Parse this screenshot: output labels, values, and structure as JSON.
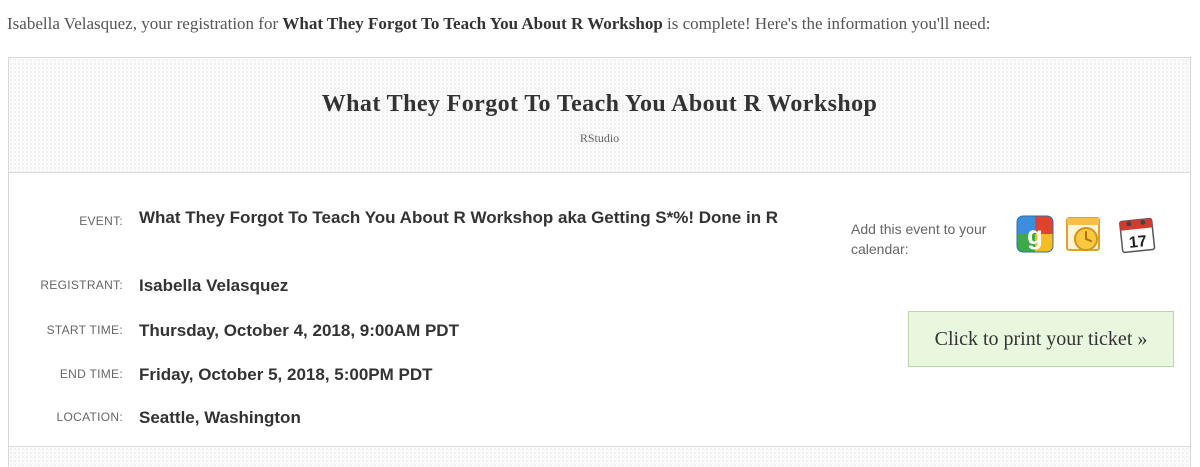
{
  "intro": {
    "prefix": "Isabella Velasquez, your registration for ",
    "event_name": "What They Forgot To Teach You About R Workshop",
    "suffix": " is complete! Here's the information you'll need:"
  },
  "header": {
    "title": "What They Forgot To Teach You About R Workshop",
    "organizer": "RStudio"
  },
  "details": {
    "event_label": "EVENT:",
    "event_value": "What They Forgot To Teach You About R Workshop aka Getting S*%! Done in R",
    "registrant_label": "REGISTRANT:",
    "registrant_value": "Isabella Velasquez",
    "start_label": "START TIME:",
    "start_value": "Thursday, October 4, 2018, 9:00AM PDT",
    "end_label": "END TIME:",
    "end_value": "Friday, October 5, 2018, 5:00PM PDT",
    "location_label": "LOCATION:",
    "location_value": "Seattle, Washington"
  },
  "calendar": {
    "prompt": "Add this event to your calendar:",
    "icons": [
      "google-calendar-icon",
      "outlook-calendar-icon",
      "ical-calendar-icon"
    ],
    "ical_day": "17"
  },
  "print_button": {
    "label": "Click to print your ticket »",
    "accent_border": "#b9d7a6",
    "accent_bg": "#e9f7df"
  }
}
